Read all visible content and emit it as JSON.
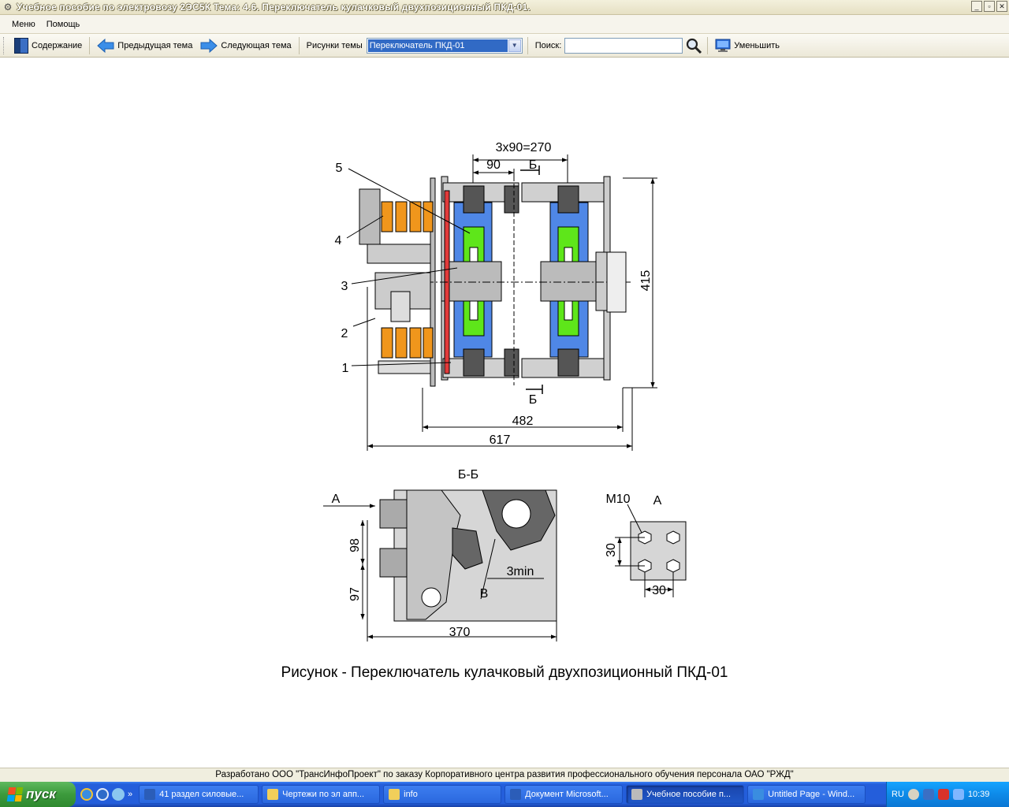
{
  "window": {
    "title": "Учебное пособие по электровозу 2ЭС5К Тема: 4.6. Переключатель кулачковый двухпозиционный ПКД-01.",
    "icon": "gear-icon"
  },
  "menu": [
    "Меню",
    "Помощь"
  ],
  "toolbar": {
    "contents": "Содержание",
    "prev_topic": "Предыдущая тема",
    "next_topic": "Следующая тема",
    "figures_label": "Рисунки темы",
    "figures_selected": "Переключатель ПКД-01",
    "search_label": "Поиск:",
    "search_value": "",
    "zoom_out": "Уменьшить"
  },
  "figure": {
    "dim_top": "3х90=270",
    "dim_90": "90",
    "section_mark": "Б",
    "dim_415": "415",
    "dim_482": "482",
    "dim_617": "617",
    "callouts": [
      "1",
      "2",
      "3",
      "4",
      "5"
    ],
    "section_title": "Б-Б",
    "view_a": "А",
    "dim_98": "98",
    "dim_97": "97",
    "dim_370": "370",
    "dim_3min": "3min",
    "mark_v": "В",
    "thread": "М10",
    "dim_30_v": "30",
    "dim_30_h": "30"
  },
  "caption": "Рисунок - Переключатель кулачковый двухпозиционный ПКД-01",
  "footer": "Разработано ООО \"ТрансИнфоПроект\" по заказу Корпоративного центра развития профессионального обучения персонала ОАО \"РЖД\"",
  "taskbar": {
    "start": "пуск",
    "tasks": [
      {
        "label": "41 раздел силовые...",
        "icon": "word-icon",
        "active": false
      },
      {
        "label": "Чертежи по эл апп...",
        "icon": "folder-icon",
        "active": false
      },
      {
        "label": "info",
        "icon": "folder-icon",
        "active": false
      },
      {
        "label": "Документ Microsoft...",
        "icon": "word-icon",
        "active": false
      },
      {
        "label": "Учебное пособие п...",
        "icon": "gear-icon",
        "active": true
      },
      {
        "label": "Untitled Page - Wind...",
        "icon": "ie-icon",
        "active": false
      }
    ],
    "lang": "RU",
    "time": "10:39"
  }
}
